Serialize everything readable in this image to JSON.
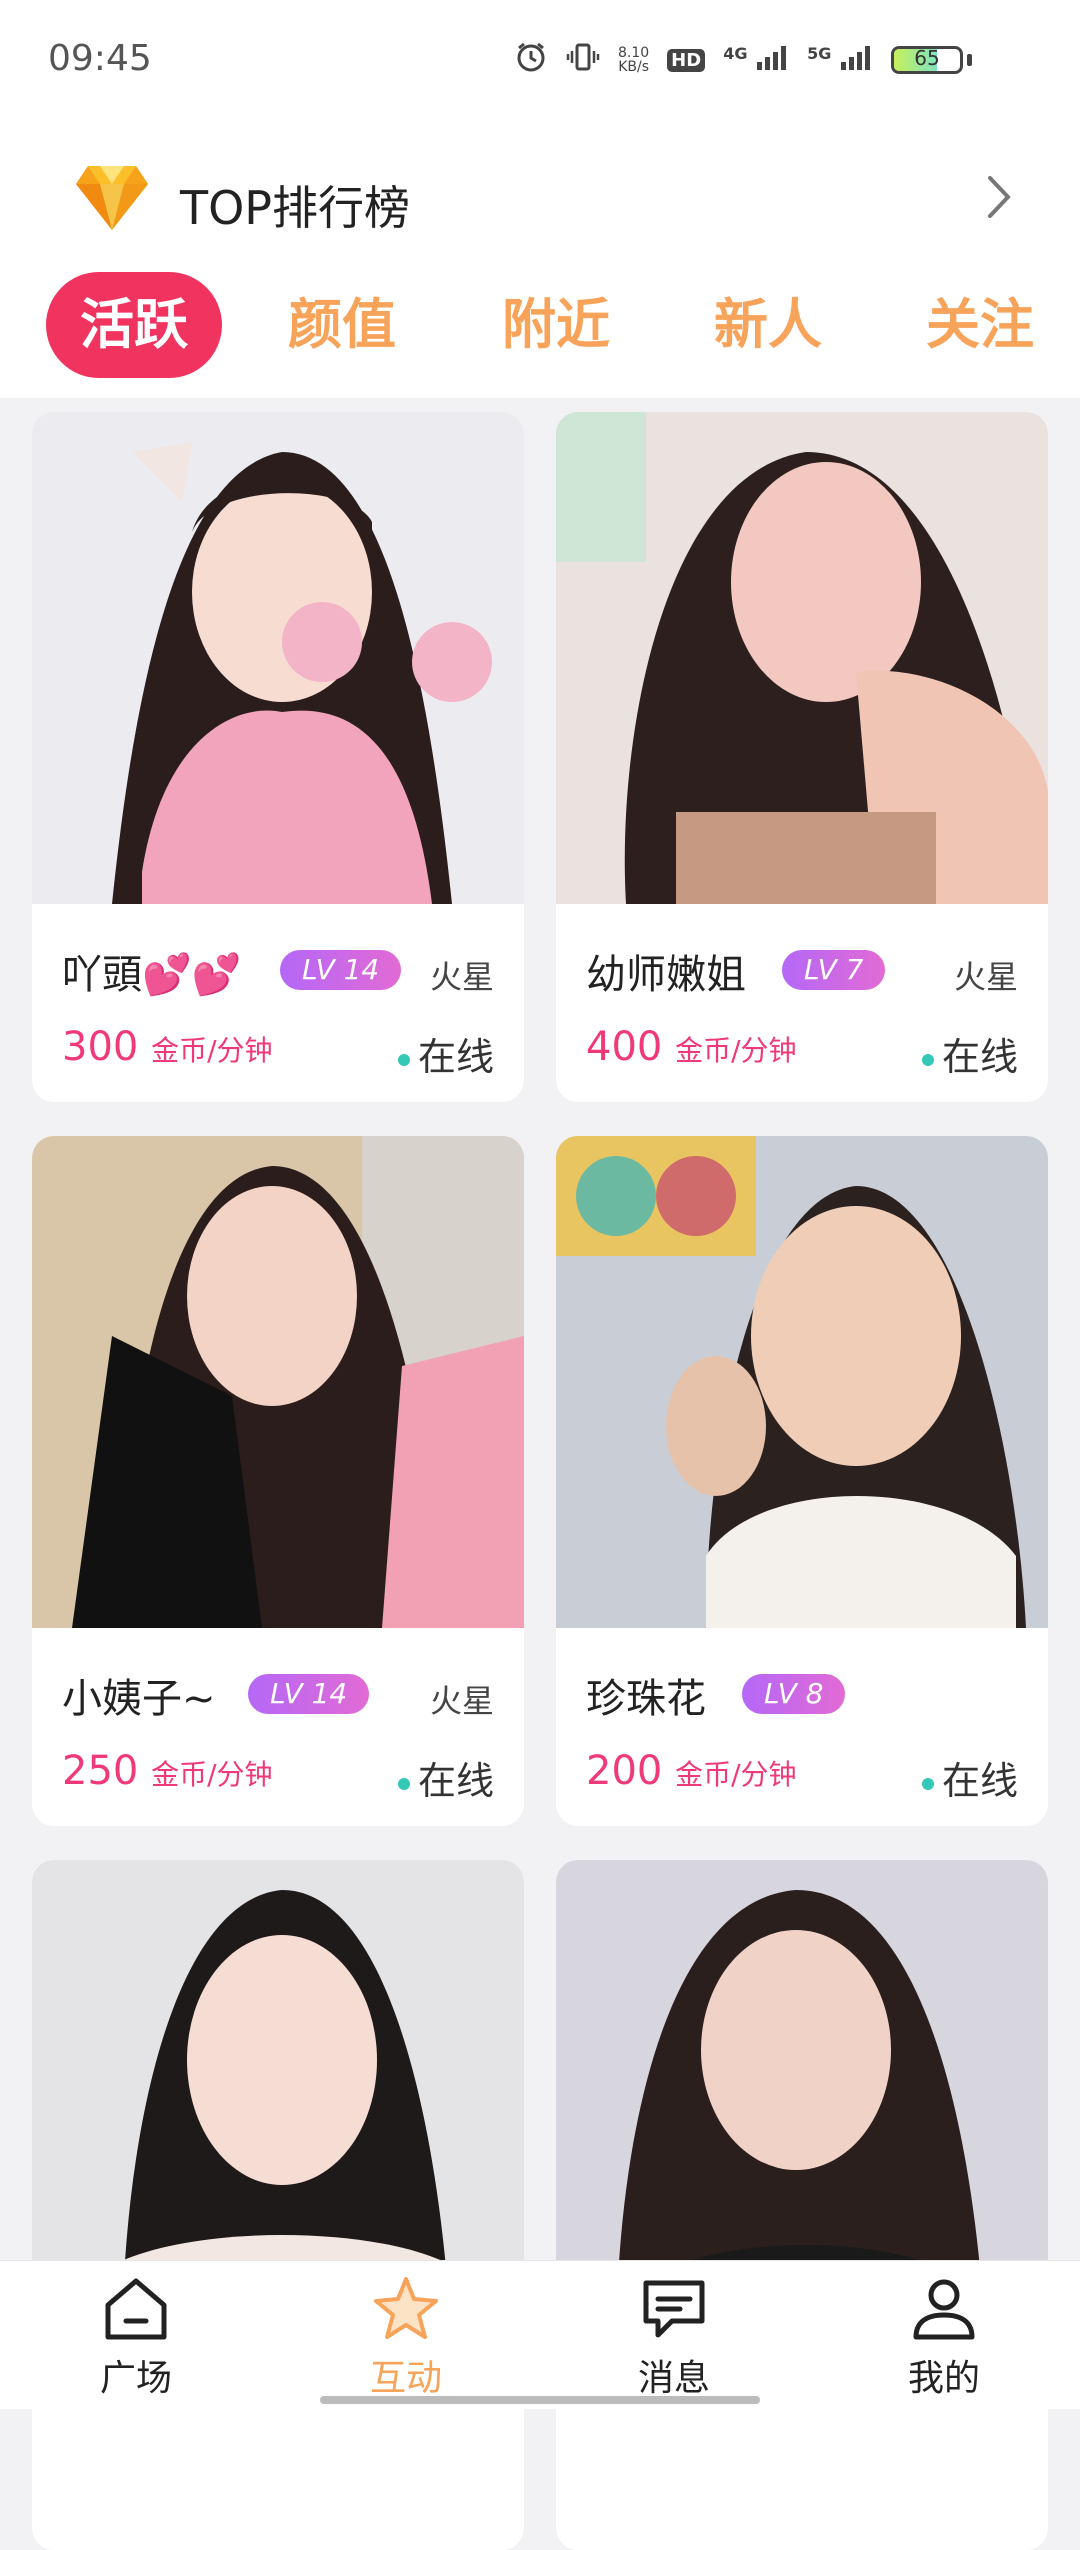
{
  "status_bar": {
    "time": "09:45",
    "net_speed_top": "8.10",
    "net_speed_unit": "KB/s",
    "hd_label": "HD",
    "sim1_label": "4G",
    "sim2_label": "5G",
    "battery_level": "65"
  },
  "header": {
    "title": "TOP排行榜",
    "icon": "diamond-icon"
  },
  "tabs": [
    {
      "label": "活跃",
      "active": true
    },
    {
      "label": "颜值",
      "active": false
    },
    {
      "label": "附近",
      "active": false
    },
    {
      "label": "新人",
      "active": false
    },
    {
      "label": "关注",
      "active": false
    }
  ],
  "cards": [
    {
      "name": "吖頭💕💕",
      "level": "LV 14",
      "location": "火星",
      "price": "300",
      "unit": "金币/分钟",
      "status": "在线"
    },
    {
      "name": "幼师嫩姐",
      "level": "LV 7",
      "location": "火星",
      "price": "400",
      "unit": "金币/分钟",
      "status": "在线"
    },
    {
      "name": "小姨子~",
      "level": "LV 14",
      "location": "火星",
      "price": "250",
      "unit": "金币/分钟",
      "status": "在线"
    },
    {
      "name": "珍珠花",
      "level": "LV 8",
      "location": "",
      "price": "200",
      "unit": "金币/分钟",
      "status": "在线"
    },
    {
      "name": "",
      "level": "",
      "location": "",
      "price": "",
      "unit": "",
      "status": ""
    },
    {
      "name": "",
      "level": "",
      "location": "",
      "price": "",
      "unit": "",
      "status": ""
    }
  ],
  "bottom_nav": [
    {
      "label": "广场",
      "icon": "plaza-icon",
      "active": false
    },
    {
      "label": "互动",
      "icon": "star-icon",
      "active": true
    },
    {
      "label": "消息",
      "icon": "message-icon",
      "active": false
    },
    {
      "label": "我的",
      "icon": "user-icon",
      "active": false
    }
  ],
  "colors": {
    "accent": "#f1335f",
    "tab_inactive": "#f7a35a",
    "price": "#f0397a",
    "online": "#33c9b6"
  }
}
